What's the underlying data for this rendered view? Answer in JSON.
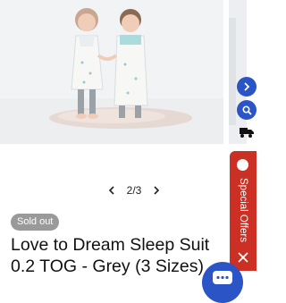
{
  "gallery": {
    "pager_text": "2/3",
    "prev_icon": "chevron-left-icon",
    "next_icon": "chevron-right-icon"
  },
  "product": {
    "status_badge": "Sold out",
    "title": "Love to Dream Sleep Suit 0.2 TOG - Grey (3 Sizes)"
  },
  "side_widgets": {
    "arrow_icon": "chevron-right-icon",
    "search_icon": "search-icon",
    "shipping_icon": "truck-icon"
  },
  "special_offers": {
    "label": "Special Offers",
    "close_icon": "close-icon"
  },
  "chat": {
    "icon": "chat-icon"
  },
  "colors": {
    "accent_blue": "#2b55c7",
    "offers_red": "#cc2f23",
    "badge_grey": "#9a9a9a"
  }
}
